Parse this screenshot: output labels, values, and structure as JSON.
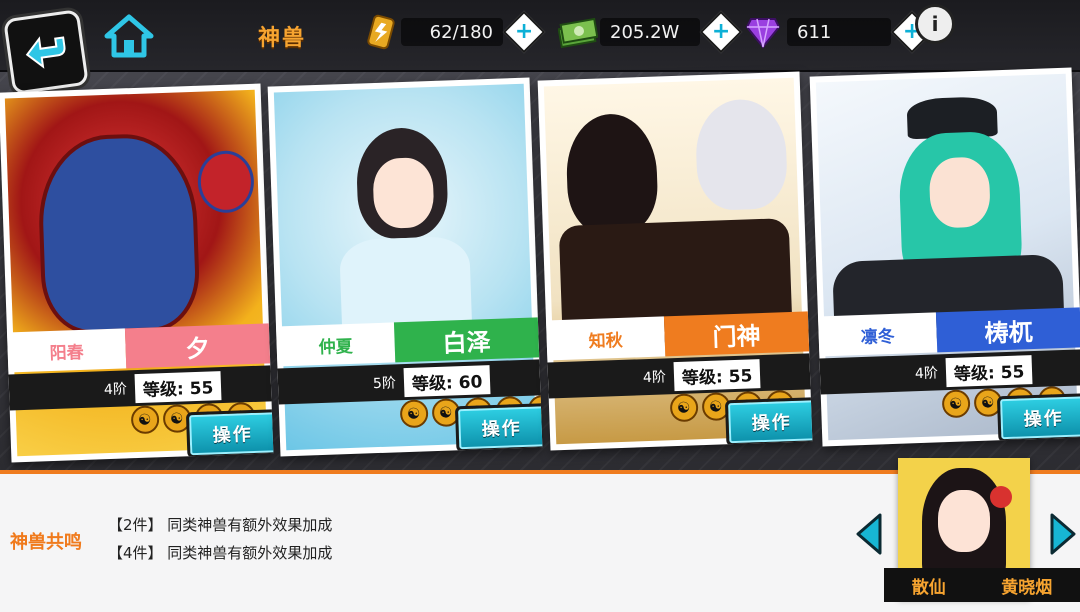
{
  "header": {
    "title": "神兽",
    "stamina": "62/180",
    "gold": "205.2W",
    "gems": "611",
    "info_glyph": "i",
    "plus_glyph": "+"
  },
  "cards": [
    {
      "name": "阳春",
      "title": "夕",
      "tier": "4阶",
      "level": "等级: 55",
      "action": "操作",
      "accent": "#f47f8c",
      "title_color": "#f47f8c"
    },
    {
      "name": "仲夏",
      "title": "白泽",
      "tier": "5阶",
      "level": "等级: 60",
      "action": "操作",
      "accent": "#2fb24c",
      "title_color": "#2fb24c"
    },
    {
      "name": "知秋",
      "title": "门神",
      "tier": "4阶",
      "level": "等级: 55",
      "action": "操作",
      "accent": "#ef7c1f",
      "title_color": "#ef7c1f"
    },
    {
      "name": "凛冬",
      "title": "梼杌",
      "tier": "4阶",
      "level": "等级: 55",
      "action": "操作",
      "accent": "#2f5fd6",
      "title_color": "#2f5fd6"
    }
  ],
  "resonance": {
    "label": "神兽共鸣",
    "bonuses": [
      "【2件】 同类神兽有额外效果加成",
      "【4件】 同类神兽有额外效果加成"
    ]
  },
  "character": {
    "role": "散仙",
    "name": "黄晓烟"
  },
  "colors": {
    "accent_orange": "#ef7c1f",
    "cyan": "#16b8d6"
  }
}
